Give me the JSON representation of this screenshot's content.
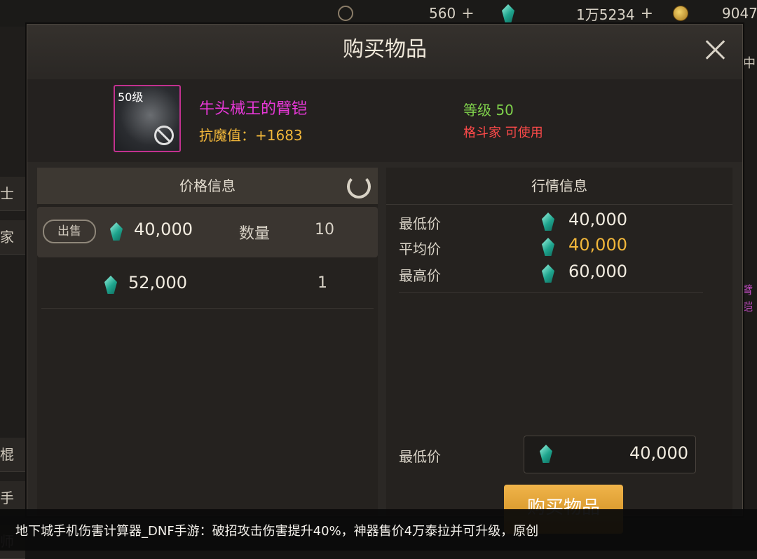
{
  "topbar": {
    "currency1": "560",
    "currency2": "1万5234",
    "currency3": "9047",
    "plus": "+"
  },
  "modal": {
    "title": "购买物品",
    "item": {
      "level_badge": "50级",
      "name": "牛头械王的臂铠",
      "stat": "抗魔值：+1683",
      "level_req": "等级 50",
      "class_req": "格斗家 可使用"
    },
    "price_panel": {
      "header": "价格信息",
      "rows": [
        {
          "sell_label": "出售",
          "price": "40,000",
          "qty_label": "数量",
          "qty": "10"
        },
        {
          "price": "52,000",
          "qty": "1"
        }
      ]
    },
    "market_panel": {
      "header": "行情信息",
      "lowest_label": "最低价",
      "lowest": "40,000",
      "avg_label": "平均价",
      "avg": "40,000",
      "highest_label": "最高价",
      "highest": "60,000"
    },
    "bottom": {
      "lowest_label": "最低价",
      "lowest_value": "40,000",
      "buy_label": "购买物品"
    }
  },
  "side_left": [
    "士",
    "家",
    "棍",
    "手",
    "师"
  ],
  "side_right": [
    "中",
    "臂铠"
  ],
  "caption": "地下城手机伤害计算器_DNF手游：破招攻击伤害提升40%，神器售价4万泰拉并可升级，原创",
  "colors": {
    "accent_gold": "#f2b73a",
    "item_purple": "#e838d8",
    "level_green": "#7fd14b",
    "class_red": "#ff4a4a"
  }
}
